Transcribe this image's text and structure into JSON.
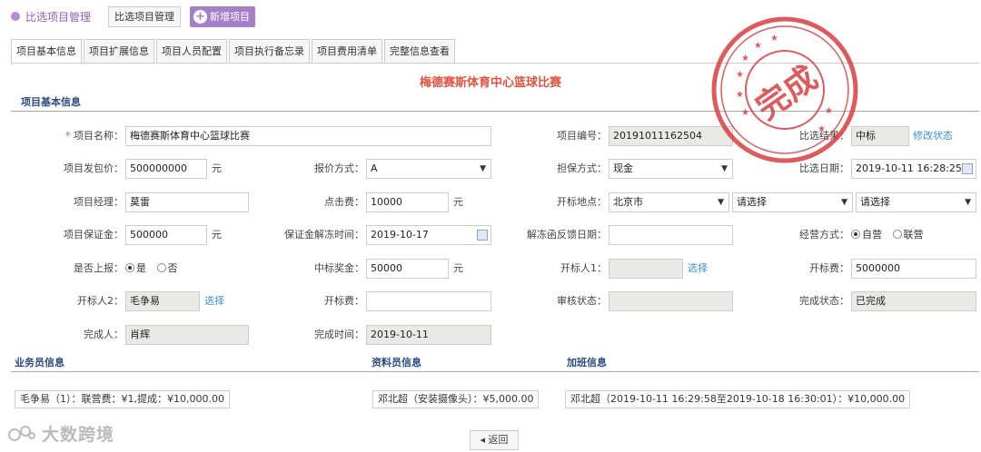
{
  "topbar": {
    "breadcrumb": "比选项目管理",
    "manage_button": "比选项目管理",
    "add_button": "新增项目"
  },
  "tabs": [
    "项目基本信息",
    "项目扩展信息",
    "项目人员配置",
    "项目执行备忘录",
    "项目费用清单",
    "完整信息查看"
  ],
  "page_title": "梅德赛斯体育中心篮球比赛",
  "section_basic": "项目基本信息",
  "form": {
    "project_name": {
      "label": "项目名称：",
      "value": "梅德赛斯体育中心篮球比赛"
    },
    "project_no": {
      "label": "项目编号：",
      "value": "20191011162504"
    },
    "bid_result": {
      "label": "比选结果：",
      "value": "中标",
      "link": "修改状态"
    },
    "contract_price": {
      "label": "项目发包价：",
      "value": "500000000",
      "unit": "元"
    },
    "quote_method": {
      "label": "报价方式：",
      "value": "A"
    },
    "guarantee_method": {
      "label": "担保方式：",
      "value": "现金"
    },
    "bid_date": {
      "label": "比选日期：",
      "value": "2019-10-11 16:28:25"
    },
    "manager": {
      "label": "项目经理：",
      "value": "莫雷"
    },
    "click_fee": {
      "label": "点击费：",
      "value": "10000",
      "unit": "元"
    },
    "bid_location": {
      "label": "开标地点：",
      "city": "北京市",
      "district": "请选择",
      "area": "请选择"
    },
    "deposit": {
      "label": "项目保证金：",
      "value": "500000",
      "unit": "元"
    },
    "deposit_unfreeze": {
      "label": "保证金解冻时间：",
      "value": "2019-10-17"
    },
    "unfreeze_feedback": {
      "label": "解冻函反馈日期：",
      "value": ""
    },
    "operation_mode": {
      "label": "经营方式：",
      "options": [
        "自营",
        "联营"
      ],
      "selected": "自营"
    },
    "reported": {
      "label": "是否上报：",
      "options": [
        "是",
        "否"
      ],
      "selected": "是"
    },
    "bonus": {
      "label": "中标奖金：",
      "value": "50000",
      "unit": "元"
    },
    "bidder1": {
      "label": "开标人1：",
      "value": "",
      "link": "选择"
    },
    "bid_fee": {
      "label": "开标费：",
      "value": "5000000"
    },
    "bidder2": {
      "label": "开标人2：",
      "value": "毛争易",
      "link": "选择"
    },
    "bid_fee2": {
      "label": "开标费：",
      "value": ""
    },
    "review_status": {
      "label": "审核状态：",
      "value": ""
    },
    "complete_status": {
      "label": "完成状态：",
      "value": "已完成"
    },
    "finisher": {
      "label": "完成人：",
      "value": "肖辉"
    },
    "finish_time": {
      "label": "完成时间：",
      "value": "2019-10-11"
    }
  },
  "sections": {
    "salesman": {
      "title": "业务员信息",
      "tag": "毛争易（1）：联营费：¥1,提成：¥10,000.00"
    },
    "material": {
      "title": "资料员信息",
      "tag": "邓北超（安装摄像头）：¥5,000.00"
    },
    "overtime": {
      "title": "加班信息",
      "tag": "邓北超（2019-10-11 16:29:58至2019-10-18 16:30:01）：¥10,000.00"
    }
  },
  "back_button": "返回",
  "stamp_text": "完成",
  "watermark": "大数跨境",
  "colors": {
    "accent": "#a67fc9",
    "title_red": "#e0533c",
    "link": "#3a8fd8",
    "section": "#2b4a80",
    "stamp": "#d9363a"
  }
}
